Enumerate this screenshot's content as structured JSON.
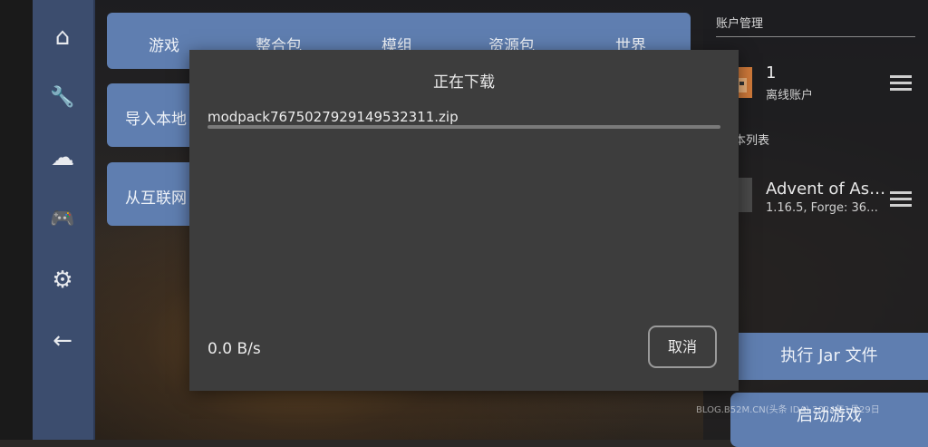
{
  "sidebar": {
    "items": [
      {
        "icon": "home-icon",
        "glyph": "⌂"
      },
      {
        "icon": "wrench-icon",
        "glyph": "🔧"
      },
      {
        "icon": "cloud-download-icon",
        "glyph": "☁"
      },
      {
        "icon": "gamepad-icon",
        "glyph": "🎮"
      },
      {
        "icon": "gear-icon",
        "glyph": "⚙"
      },
      {
        "icon": "back-arrow-icon",
        "glyph": "←"
      }
    ]
  },
  "tabs": [
    "游戏",
    "整合包",
    "模组",
    "资源包",
    "世界"
  ],
  "menu": {
    "import_local": "导入本地",
    "from_internet": "从互联网"
  },
  "right_panel": {
    "account_header": "账户管理",
    "account_name": "1",
    "account_type": "离线账户",
    "version_header": "本列表",
    "version_name": "Advent of As…",
    "version_detail": "1.16.5, Forge: 36…",
    "run_jar": "执行 Jar 文件",
    "launch_game": "启动游戏"
  },
  "watermark": "BLOG.B52M.CN(头条 IDA) 2024年1月29日",
  "dialog": {
    "title": "正在下载",
    "filename": "modpack7675027929149532311.zip",
    "progress": 0,
    "speed": "0.0 B/s",
    "cancel_label": "取消"
  },
  "colors": {
    "sidebar": "#3c4d6e",
    "accent": "#5f7eb0",
    "dialog": "#3d3d3d"
  }
}
